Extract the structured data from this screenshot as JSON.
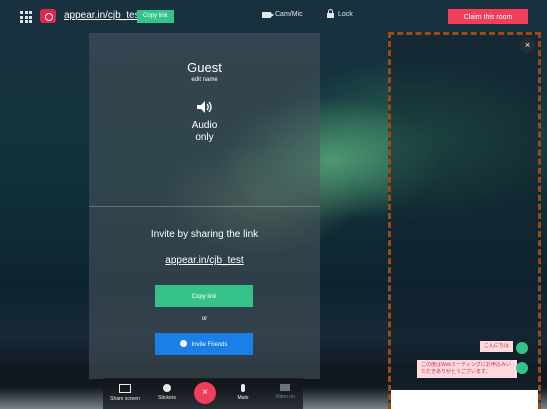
{
  "topbar": {
    "room_url": "appear.in/cjb_test",
    "copy_link_label": "Copy link",
    "cam_mic_label": "Cam/Mic",
    "lock_label": "Lock",
    "claim_room_label": "Claim this room"
  },
  "self_panel": {
    "name": "Guest",
    "edit_name_label": "edit name",
    "audio_status": "Audio\nonly"
  },
  "invite": {
    "heading": "Invite by sharing the link",
    "link": "appear.in/cjb_test",
    "copy_link_label": "Copy link",
    "or_text": "or",
    "invite_friends_label": "Invite Friends"
  },
  "toolbar": {
    "share_screen_label": "Share screen",
    "stickers_label": "Stickers",
    "leave_label": "×",
    "mute_label": "Mute",
    "video_label": "Video on"
  },
  "chat": {
    "close_label": "×",
    "messages": [
      {
        "text": "こんにちは"
      },
      {
        "text": "この度はWebミーティングにお申込みいただきありがとうございます。"
      }
    ],
    "input_value": ""
  },
  "colors": {
    "accent_green": "#36c28b",
    "accent_red": "#f13e5a",
    "accent_blue": "#1a7fe6",
    "highlight_border": "#9a4a16"
  }
}
